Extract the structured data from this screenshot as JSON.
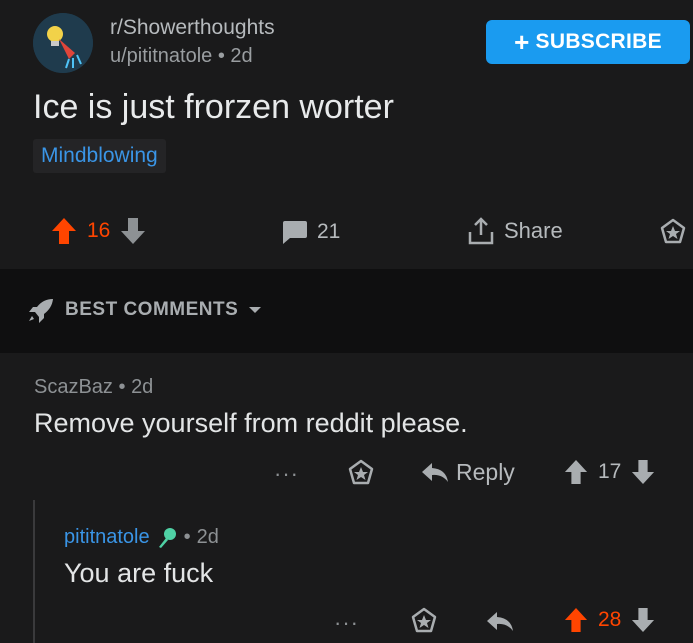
{
  "post": {
    "subreddit": "r/Showerthoughts",
    "author": "u/pititnatole",
    "age": "2d",
    "subscribe_label": "SUBSCRIBE",
    "title": "Ice is just frorzen worter",
    "flair": "Mindblowing",
    "upvotes": "16",
    "comment_count": "21",
    "share_label": "Share"
  },
  "sort": {
    "label": "BEST COMMENTS"
  },
  "comments": [
    {
      "author": "ScazBaz",
      "age": "2d",
      "body": "Remove yourself from reddit please.",
      "more_label": "···",
      "reply_label": "Reply",
      "score": "17"
    },
    {
      "author": "pititnatole",
      "age": "2d",
      "body": "You are fuck",
      "more_label": "···",
      "score": "28"
    }
  ],
  "colors": {
    "accent": "#1a9bf0",
    "upvote": "#ff4500",
    "link": "#3a95e6",
    "background": "#1a1a1b"
  }
}
